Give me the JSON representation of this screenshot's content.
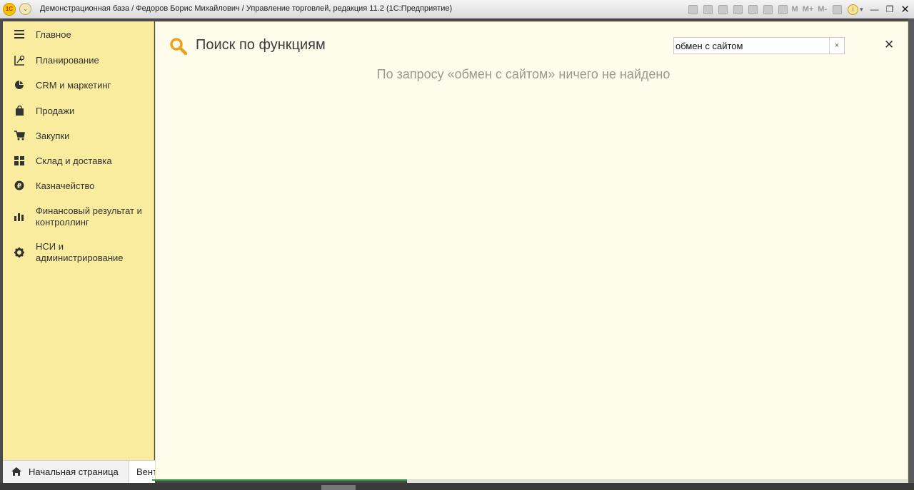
{
  "window": {
    "title": "Демонстрационная база / Федоров Борис Михайлович / Управление торговлей, редакция 11.2  (1С:Предприятие)",
    "logo_text": "1С",
    "toolbar_m_labels": [
      "M",
      "M+",
      "M-"
    ]
  },
  "sidebar": {
    "items": [
      {
        "label": "Главное",
        "icon": "hamburger-icon"
      },
      {
        "label": "Планирование",
        "icon": "planning-icon"
      },
      {
        "label": "CRM и маркетинг",
        "icon": "pie-chart-icon"
      },
      {
        "label": "Продажи",
        "icon": "shopping-bag-icon"
      },
      {
        "label": "Закупки",
        "icon": "cart-icon"
      },
      {
        "label": "Склад и доставка",
        "icon": "grid-icon"
      },
      {
        "label": "Казначейство",
        "icon": "ruble-coin-icon"
      },
      {
        "label": "Финансовый результат и контроллинг",
        "icon": "bar-chart-icon"
      },
      {
        "label": "НСИ и администрирование",
        "icon": "gear-icon"
      }
    ]
  },
  "search_panel": {
    "title": "Поиск по функциям",
    "query": "обмен с сайтом",
    "clear_symbol": "×",
    "close_symbol": "✕",
    "result_message": "По запросу «обмен с сайтом» ничего не найдено"
  },
  "tabs": {
    "home_label": "Начальная страница",
    "second_label": "Вент"
  },
  "colors": {
    "sidebar_bg": "#faec9e",
    "panel_bg": "#fefdec",
    "accent_search": "#f0a020",
    "active_tab_underline": "#2e9e3e"
  }
}
